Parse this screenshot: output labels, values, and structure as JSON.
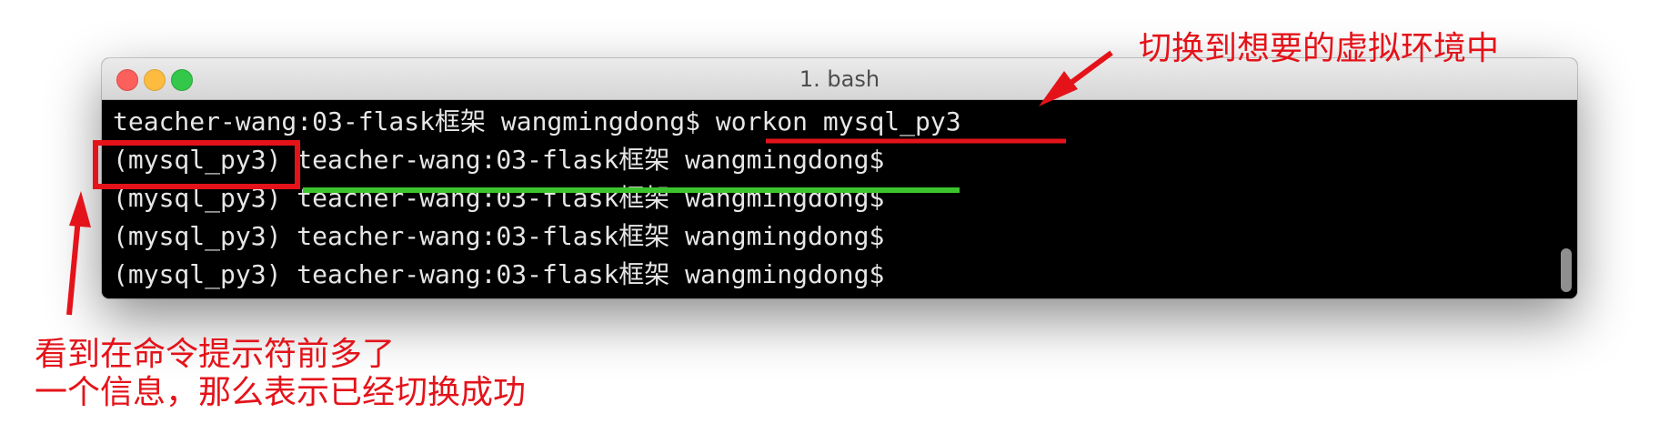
{
  "window": {
    "title": "1. bash"
  },
  "terminal": {
    "lines": [
      "teacher-wang:03-flask框架 wangmingdong$ workon mysql_py3",
      "(mysql_py3) teacher-wang:03-flask框架 wangmingdong$",
      "(mysql_py3) teacher-wang:03-flask框架 wangmingdong$",
      "(mysql_py3) teacher-wang:03-flask框架 wangmingdong$",
      "(mysql_py3) teacher-wang:03-flask框架 wangmingdong$"
    ]
  },
  "annotations": {
    "top_right": "切换到想要的虚拟环境中",
    "bottom_left_line1": "看到在命令提示符前多了",
    "bottom_left_line2": "一个信息，那么表示已经切换成功"
  },
  "colors": {
    "annotation_red": "#e4131a",
    "highlight_green": "#3cc42c",
    "terminal_bg": "#000000",
    "terminal_text": "#e6e6e6"
  }
}
